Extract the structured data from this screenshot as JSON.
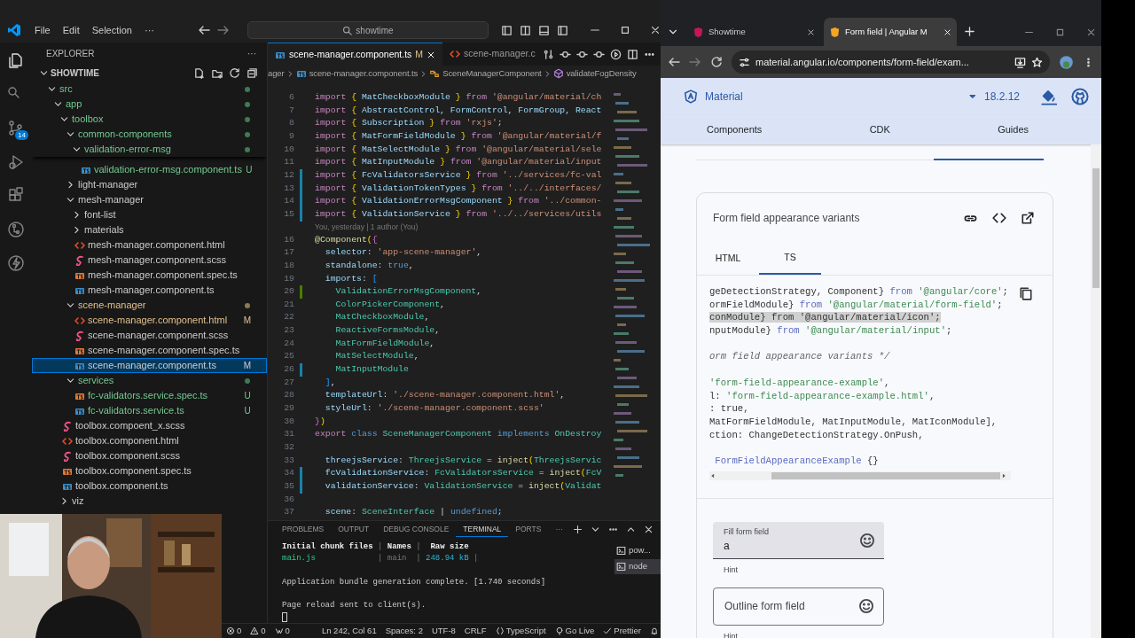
{
  "vscode": {
    "menu": [
      "File",
      "Edit",
      "Selection",
      "···"
    ],
    "search": {
      "value": "showtime"
    },
    "activity_bar": [
      {
        "kind": "explorer",
        "selected": true
      },
      {
        "kind": "search",
        "selected": false
      },
      {
        "kind": "source-control",
        "selected": false,
        "badge": "14"
      },
      {
        "kind": "run-debug",
        "selected": false
      },
      {
        "kind": "extensions",
        "selected": false
      },
      {
        "kind": "git-graph",
        "selected": false
      },
      {
        "kind": "lightning",
        "selected": false
      }
    ],
    "explorer": {
      "title": "EXPLORER",
      "more": "···",
      "section": {
        "label": "SHOWTIME",
        "expanded": true
      },
      "tree": [
        {
          "label": "src",
          "kind": "folder",
          "expanded": true,
          "untracked": true,
          "selected": false,
          "children": [
            {
              "label": "app",
              "kind": "folder",
              "expanded": true,
              "untracked": true,
              "selected": false,
              "children": [
                {
                  "label": "toolbox",
                  "kind": "folder",
                  "expanded": true,
                  "untracked": true,
                  "selected": false,
                  "children": [
                    {
                      "label": "common-components",
                      "kind": "folder",
                      "expanded": true,
                      "untracked": true,
                      "selected": false,
                      "children": [
                        {
                          "label": "validation-error-msg",
                          "kind": "folder",
                          "expanded": true,
                          "untracked": true,
                          "selected": false,
                          "sticky": true,
                          "children": [
                            {
                              "label": "validation-error-msg.component.ts",
                              "kind": "ts",
                              "untracked": true,
                              "badge": "U",
                              "selected": false
                            }
                          ]
                        }
                      ]
                    },
                    {
                      "label": "light-manager",
                      "kind": "folder",
                      "expanded": false,
                      "selected": false
                    },
                    {
                      "label": "mesh-manager",
                      "kind": "folder",
                      "expanded": true,
                      "selected": false,
                      "children": [
                        {
                          "label": "font-list",
                          "kind": "folder",
                          "expanded": false,
                          "selected": false
                        },
                        {
                          "label": "materials",
                          "kind": "folder",
                          "expanded": false,
                          "selected": false
                        },
                        {
                          "label": "mesh-manager.component.html",
                          "kind": "html",
                          "selected": false
                        },
                        {
                          "label": "mesh-manager.component.scss",
                          "kind": "scss",
                          "selected": false
                        },
                        {
                          "label": "mesh-manager.component.spec.ts",
                          "kind": "spec",
                          "selected": false
                        },
                        {
                          "label": "mesh-manager.component.ts",
                          "kind": "ts",
                          "selected": false
                        }
                      ]
                    },
                    {
                      "label": "scene-manager",
                      "kind": "folder",
                      "expanded": true,
                      "modified": true,
                      "selected": false,
                      "children": [
                        {
                          "label": "scene-manager.component.html",
                          "kind": "html",
                          "modified": true,
                          "badge": "M",
                          "selected": false
                        },
                        {
                          "label": "scene-manager.component.scss",
                          "kind": "scss",
                          "selected": false
                        },
                        {
                          "label": "scene-manager.component.spec.ts",
                          "kind": "spec",
                          "selected": false
                        },
                        {
                          "label": "scene-manager.component.ts",
                          "kind": "ts",
                          "badge": "M",
                          "selected": true
                        }
                      ]
                    },
                    {
                      "label": "services",
                      "kind": "folder",
                      "expanded": true,
                      "untracked": true,
                      "selected": false,
                      "children": [
                        {
                          "label": "fc-validators.service.spec.ts",
                          "kind": "spec",
                          "untracked": true,
                          "badge": "U",
                          "selected": false
                        },
                        {
                          "label": "fc-validators.service.ts",
                          "kind": "ts",
                          "untracked": true,
                          "badge": "U",
                          "selected": false
                        }
                      ]
                    }
                  ]
                },
                {
                  "label": "toolbox.compoent_x.scss",
                  "kind": "scss",
                  "selected": false
                },
                {
                  "label": "toolbox.component.html",
                  "kind": "html",
                  "selected": false
                },
                {
                  "label": "toolbox.component.scss",
                  "kind": "scss",
                  "selected": false
                },
                {
                  "label": "toolbox.component.spec.ts",
                  "kind": "spec",
                  "selected": false
                },
                {
                  "label": "toolbox.component.ts",
                  "kind": "ts",
                  "selected": false
                },
                {
                  "label": "viz",
                  "kind": "folder",
                  "expanded": false,
                  "selected": false
                }
              ]
            }
          ]
        }
      ]
    },
    "editor_tabs": [
      {
        "label": "scene-manager.component.ts",
        "kind": "ts",
        "badge": "M",
        "selected": true
      },
      {
        "label": "scene-manager.c",
        "kind": "html",
        "selected": false
      }
    ],
    "breadcrumb": [
      {
        "kind": "text",
        "label": "ager"
      },
      {
        "kind": "ts",
        "label": "scene-manager.component.ts"
      },
      {
        "kind": "class",
        "label": "SceneManagerComponent"
      },
      {
        "kind": "method",
        "label": "validateFogDensity"
      }
    ],
    "code_lines": [
      {
        "kind": "code",
        "number": "6",
        "tokens": [
          {
            "kind": "keyword",
            "text": "import "
          },
          {
            "kind": "bracket",
            "text": "{"
          },
          {
            "kind": "property",
            "text": " MatCheckboxModule "
          },
          {
            "kind": "bracket",
            "text": "}"
          },
          {
            "kind": "keyword",
            "text": " from "
          },
          {
            "kind": "string",
            "text": "'@angular/material/ch"
          }
        ]
      },
      {
        "kind": "code",
        "number": "7",
        "tokens": [
          {
            "kind": "keyword",
            "text": "import "
          },
          {
            "kind": "bracket",
            "text": "{"
          },
          {
            "kind": "property",
            "text": " AbstractControl, FormControl, FormGroup, React"
          }
        ]
      },
      {
        "kind": "code",
        "number": "8",
        "tokens": [
          {
            "kind": "keyword",
            "text": "import "
          },
          {
            "kind": "bracket",
            "text": "{"
          },
          {
            "kind": "property",
            "text": " Subscription "
          },
          {
            "kind": "bracket",
            "text": "}"
          },
          {
            "kind": "keyword",
            "text": " from "
          },
          {
            "kind": "string",
            "text": "'rxjs'"
          },
          {
            "kind": "plain",
            "text": ";"
          }
        ]
      },
      {
        "kind": "code",
        "number": "9",
        "tokens": [
          {
            "kind": "keyword",
            "text": "import "
          },
          {
            "kind": "bracket",
            "text": "{"
          },
          {
            "kind": "property",
            "text": " MatFormFieldModule "
          },
          {
            "kind": "bracket",
            "text": "}"
          },
          {
            "kind": "keyword",
            "text": " from "
          },
          {
            "kind": "string",
            "text": "'@angular/material/f"
          }
        ]
      },
      {
        "kind": "code",
        "number": "10",
        "tokens": [
          {
            "kind": "keyword",
            "text": "import "
          },
          {
            "kind": "bracket",
            "text": "{"
          },
          {
            "kind": "property",
            "text": " MatSelectModule "
          },
          {
            "kind": "bracket",
            "text": "}"
          },
          {
            "kind": "keyword",
            "text": " from "
          },
          {
            "kind": "string",
            "text": "'@angular/material/sele"
          }
        ]
      },
      {
        "kind": "code",
        "number": "11",
        "tokens": [
          {
            "kind": "keyword",
            "text": "import "
          },
          {
            "kind": "bracket",
            "text": "{"
          },
          {
            "kind": "property",
            "text": " MatInputModule "
          },
          {
            "kind": "bracket",
            "text": "}"
          },
          {
            "kind": "keyword",
            "text": " from "
          },
          {
            "kind": "string",
            "text": "'@angular/material/input"
          }
        ]
      },
      {
        "kind": "code",
        "number": "12",
        "modified": true,
        "tokens": [
          {
            "kind": "keyword",
            "text": "import "
          },
          {
            "kind": "bracket",
            "text": "{"
          },
          {
            "kind": "property",
            "text": " FcValidatorsService "
          },
          {
            "kind": "bracket",
            "text": "}"
          },
          {
            "kind": "keyword",
            "text": " from "
          },
          {
            "kind": "string",
            "text": "'../services/fc-val"
          }
        ]
      },
      {
        "kind": "code",
        "number": "13",
        "modified": true,
        "tokens": [
          {
            "kind": "keyword",
            "text": "import "
          },
          {
            "kind": "bracket",
            "text": "{"
          },
          {
            "kind": "property",
            "text": " ValidationTokenTypes "
          },
          {
            "kind": "bracket",
            "text": "}"
          },
          {
            "kind": "keyword",
            "text": " from "
          },
          {
            "kind": "string",
            "text": "'../../interfaces/"
          }
        ]
      },
      {
        "kind": "code",
        "number": "14",
        "modified": true,
        "tokens": [
          {
            "kind": "keyword",
            "text": "import "
          },
          {
            "kind": "bracket",
            "text": "{"
          },
          {
            "kind": "property",
            "text": " ValidationErrorMsgComponent "
          },
          {
            "kind": "bracket",
            "text": "}"
          },
          {
            "kind": "keyword",
            "text": " from "
          },
          {
            "kind": "string",
            "text": "'../common-"
          }
        ]
      },
      {
        "kind": "code",
        "number": "15",
        "modified": true,
        "tokens": [
          {
            "kind": "keyword",
            "text": "import "
          },
          {
            "kind": "bracket",
            "text": "{"
          },
          {
            "kind": "property",
            "text": " ValidationService "
          },
          {
            "kind": "bracket",
            "text": "}"
          },
          {
            "kind": "keyword",
            "text": " from "
          },
          {
            "kind": "string",
            "text": "'../../services/utils"
          }
        ]
      },
      {
        "kind": "blame",
        "text": "You, yesterday | 1 author (You)"
      },
      {
        "kind": "code",
        "number": "16",
        "tokens": [
          {
            "kind": "function",
            "text": "@Component"
          },
          {
            "kind": "bracket",
            "text": "("
          },
          {
            "kind": "bracket2",
            "text": "{"
          }
        ]
      },
      {
        "kind": "code",
        "number": "17",
        "tokens": [
          {
            "kind": "property",
            "text": "  selector"
          },
          {
            "kind": "plain",
            "text": ": "
          },
          {
            "kind": "string",
            "text": "'app-scene-manager'"
          },
          {
            "kind": "plain",
            "text": ","
          }
        ]
      },
      {
        "kind": "code",
        "number": "18",
        "tokens": [
          {
            "kind": "property",
            "text": "  standalone"
          },
          {
            "kind": "plain",
            "text": ": "
          },
          {
            "kind": "storage",
            "text": "true"
          },
          {
            "kind": "plain",
            "text": ","
          }
        ]
      },
      {
        "kind": "code",
        "number": "19",
        "tokens": [
          {
            "kind": "property",
            "text": "  imports"
          },
          {
            "kind": "plain",
            "text": ": "
          },
          {
            "kind": "bracket3",
            "text": "["
          }
        ]
      },
      {
        "kind": "code",
        "number": "20",
        "added": true,
        "tokens": [
          {
            "kind": "type",
            "text": "    ValidationErrorMsgComponent"
          },
          {
            "kind": "plain",
            "text": ","
          }
        ]
      },
      {
        "kind": "code",
        "number": "21",
        "tokens": [
          {
            "kind": "type",
            "text": "    ColorPickerComponent"
          },
          {
            "kind": "plain",
            "text": ","
          }
        ]
      },
      {
        "kind": "code",
        "number": "22",
        "tokens": [
          {
            "kind": "type",
            "text": "    MatCheckboxModule"
          },
          {
            "kind": "plain",
            "text": ","
          }
        ]
      },
      {
        "kind": "code",
        "number": "23",
        "tokens": [
          {
            "kind": "type",
            "text": "    ReactiveFormsModule"
          },
          {
            "kind": "plain",
            "text": ","
          }
        ]
      },
      {
        "kind": "code",
        "number": "24",
        "tokens": [
          {
            "kind": "type",
            "text": "    MatFormFieldModule"
          },
          {
            "kind": "plain",
            "text": ","
          }
        ]
      },
      {
        "kind": "code",
        "number": "25",
        "tokens": [
          {
            "kind": "type",
            "text": "    MatSelectModule"
          },
          {
            "kind": "plain",
            "text": ","
          }
        ]
      },
      {
        "kind": "code",
        "number": "26",
        "modified": true,
        "tokens": [
          {
            "kind": "type",
            "text": "    MatInputModule"
          }
        ]
      },
      {
        "kind": "code",
        "number": "27",
        "tokens": [
          {
            "kind": "bracket3",
            "text": "  ]"
          },
          {
            "kind": "plain",
            "text": ","
          }
        ]
      },
      {
        "kind": "code",
        "number": "28",
        "tokens": [
          {
            "kind": "property",
            "text": "  templateUrl"
          },
          {
            "kind": "plain",
            "text": ": "
          },
          {
            "kind": "string",
            "text": "'./scene-manager.component.html'"
          },
          {
            "kind": "plain",
            "text": ","
          }
        ]
      },
      {
        "kind": "code",
        "number": "29",
        "tokens": [
          {
            "kind": "property",
            "text": "  styleUrl"
          },
          {
            "kind": "plain",
            "text": ": "
          },
          {
            "kind": "string",
            "text": "'./scene-manager.component.scss'"
          }
        ]
      },
      {
        "kind": "code",
        "number": "30",
        "tokens": [
          {
            "kind": "bracket2",
            "text": "}"
          },
          {
            "kind": "bracket",
            "text": ")"
          }
        ]
      },
      {
        "kind": "code",
        "number": "31",
        "tokens": [
          {
            "kind": "keyword",
            "text": "export "
          },
          {
            "kind": "storage",
            "text": "class "
          },
          {
            "kind": "type",
            "text": "SceneManagerComponent "
          },
          {
            "kind": "storage",
            "text": "implements "
          },
          {
            "kind": "type",
            "text": "OnDestroy"
          }
        ]
      },
      {
        "kind": "code",
        "number": "32"
      },
      {
        "kind": "code",
        "number": "33",
        "tokens": [
          {
            "kind": "property",
            "text": "  threejsService"
          },
          {
            "kind": "plain",
            "text": ": "
          },
          {
            "kind": "type",
            "text": "ThreejsService"
          },
          {
            "kind": "plain",
            "text": " = "
          },
          {
            "kind": "function",
            "text": "inject"
          },
          {
            "kind": "bracket",
            "text": "("
          },
          {
            "kind": "type",
            "text": "ThreejsServic"
          }
        ]
      },
      {
        "kind": "code",
        "number": "34",
        "modified": true,
        "tokens": [
          {
            "kind": "property",
            "text": "  fcValidationService"
          },
          {
            "kind": "plain",
            "text": ": "
          },
          {
            "kind": "type",
            "text": "FcValidatorsService"
          },
          {
            "kind": "plain",
            "text": " = "
          },
          {
            "kind": "function",
            "text": "inject"
          },
          {
            "kind": "bracket",
            "text": "("
          },
          {
            "kind": "type",
            "text": "FcV"
          }
        ]
      },
      {
        "kind": "code",
        "number": "35",
        "modified": true,
        "tokens": [
          {
            "kind": "property",
            "text": "  validationService"
          },
          {
            "kind": "plain",
            "text": ": "
          },
          {
            "kind": "type",
            "text": "ValidationService"
          },
          {
            "kind": "plain",
            "text": " = "
          },
          {
            "kind": "function",
            "text": "inject"
          },
          {
            "kind": "bracket",
            "text": "("
          },
          {
            "kind": "type",
            "text": "Validat"
          }
        ]
      },
      {
        "kind": "code",
        "number": "36"
      },
      {
        "kind": "code",
        "number": "37",
        "tokens": [
          {
            "kind": "property",
            "text": "  scene"
          },
          {
            "kind": "plain",
            "text": ": "
          },
          {
            "kind": "type",
            "text": "SceneInterface"
          },
          {
            "kind": "plain",
            "text": " | "
          },
          {
            "kind": "storage",
            "text": "undefined"
          },
          {
            "kind": "plain",
            "text": ";"
          }
        ]
      }
    ],
    "panel": {
      "tabs": [
        {
          "label": "PROBLEMS",
          "selected": false
        },
        {
          "label": "OUTPUT",
          "selected": false
        },
        {
          "label": "DEBUG CONSOLE",
          "selected": false
        },
        {
          "label": "TERMINAL",
          "selected": true
        },
        {
          "label": "PORTS",
          "selected": false
        }
      ],
      "more": "···",
      "terminal_lines": [
        {
          "kind": "text",
          "segments": [
            {
              "kind": "header",
              "text": "Initial chunk files"
            },
            {
              "kind": "separator",
              "text": " | "
            },
            {
              "kind": "header",
              "text": "Names"
            },
            {
              "kind": "separator",
              "text": " | "
            },
            {
              "kind": "header",
              "text": " Raw size"
            }
          ]
        },
        {
          "kind": "text",
          "segments": [
            {
              "kind": "file",
              "text": "main.js"
            },
            {
              "kind": "separator",
              "text": "             | "
            },
            {
              "kind": "dim",
              "text": "main"
            },
            {
              "kind": "separator",
              "text": "  | "
            },
            {
              "kind": "size",
              "text": "248.94 kB"
            },
            {
              "kind": "separator",
              "text": " |"
            }
          ]
        },
        {
          "kind": "blank"
        },
        {
          "kind": "text",
          "segments": [
            {
              "kind": "plain",
              "text": "Application bundle generation complete. [1.740 seconds]"
            }
          ]
        },
        {
          "kind": "blank"
        },
        {
          "kind": "text",
          "segments": [
            {
              "kind": "plain",
              "text": "Page reload sent to client(s)."
            }
          ]
        }
      ],
      "terminals": [
        {
          "label": "pow...",
          "selected": false
        },
        {
          "label": "node",
          "selected": true
        }
      ]
    },
    "status_bar": [
      {
        "kind": "errors",
        "text": "0"
      },
      {
        "kind": "warnings",
        "text": "0"
      },
      {
        "kind": "ports",
        "text": "0"
      },
      {
        "kind": "text",
        "text": "Ln 242, Col 61"
      },
      {
        "kind": "text",
        "text": "Spaces: 2"
      },
      {
        "kind": "text",
        "text": "UTF-8"
      },
      {
        "kind": "text",
        "text": "CRLF"
      },
      {
        "kind": "language",
        "text": "TypeScript"
      },
      {
        "kind": "go-live",
        "text": "Go Live"
      },
      {
        "kind": "prettier",
        "text": "Prettier"
      },
      {
        "kind": "bell"
      }
    ]
  },
  "browser": {
    "tabs": [
      {
        "title": "Showtime",
        "kind": "angular",
        "selected": false
      },
      {
        "title": "Form field | Angular M",
        "kind": "shield",
        "selected": true
      }
    ],
    "url": "material.angular.io/components/form-field/exam...",
    "site": {
      "brand": "Material",
      "version": "18.2.12",
      "nav": [
        "Components",
        "CDK",
        "Guides"
      ]
    },
    "example": {
      "title": "Form field appearance variants",
      "tabs": [
        {
          "label": "HTML",
          "selected": false
        },
        {
          "label": "TS",
          "selected": true
        }
      ],
      "code_lines": [
        {
          "kind": "code",
          "segments": [
            {
              "kind": "plain",
              "text": "geDetectionStrategy, Component} "
            },
            {
              "kind": "keyword",
              "text": "from"
            },
            {
              "kind": "string",
              "text": " '@angular/core'"
            },
            {
              "kind": "plain",
              "text": ";"
            }
          ]
        },
        {
          "kind": "code",
          "segments": [
            {
              "kind": "plain",
              "text": "ormFieldModule} "
            },
            {
              "kind": "keyword",
              "text": "from"
            },
            {
              "kind": "string",
              "text": " '@angular/material/form-field'"
            },
            {
              "kind": "plain",
              "text": ";"
            }
          ]
        },
        {
          "kind": "code",
          "highlighted": true,
          "segments": [
            {
              "kind": "plain",
              "text": "conModule} from '@angular/material/icon';"
            }
          ]
        },
        {
          "kind": "code",
          "segments": [
            {
              "kind": "plain",
              "text": "nputModule} "
            },
            {
              "kind": "keyword",
              "text": "from"
            },
            {
              "kind": "string",
              "text": " '@angular/material/input'"
            },
            {
              "kind": "plain",
              "text": ";"
            }
          ]
        },
        {
          "kind": "blank"
        },
        {
          "kind": "code",
          "segments": [
            {
              "kind": "comment",
              "text": "orm field appearance variants */"
            }
          ]
        },
        {
          "kind": "blank"
        },
        {
          "kind": "code",
          "segments": [
            {
              "kind": "string",
              "text": "'form-field-appearance-example'"
            },
            {
              "kind": "plain",
              "text": ","
            }
          ]
        },
        {
          "kind": "code",
          "segments": [
            {
              "kind": "plain",
              "text": "l: "
            },
            {
              "kind": "string",
              "text": "'form-field-appearance-example.html'"
            },
            {
              "kind": "plain",
              "text": ","
            }
          ]
        },
        {
          "kind": "code",
          "segments": [
            {
              "kind": "plain",
              "text": ": true,"
            }
          ]
        },
        {
          "kind": "code",
          "segments": [
            {
              "kind": "plain",
              "text": "MatFormFieldModule, MatInputModule, MatIconModule],"
            }
          ]
        },
        {
          "kind": "code",
          "segments": [
            {
              "kind": "plain",
              "text": "ction: ChangeDetectionStrategy.OnPush,"
            }
          ]
        },
        {
          "kind": "blank"
        },
        {
          "kind": "code",
          "segments": [
            {
              "kind": "keyword",
              "text": " FormFieldAppearanceExample"
            },
            {
              "kind": "plain",
              "text": " {}"
            }
          ]
        }
      ]
    },
    "fields": [
      {
        "kind": "fill",
        "label": "Fill form field",
        "value": "a",
        "hint": "Hint"
      },
      {
        "kind": "outline",
        "placeholder": "Outline form field",
        "hint": "Hint"
      }
    ]
  }
}
